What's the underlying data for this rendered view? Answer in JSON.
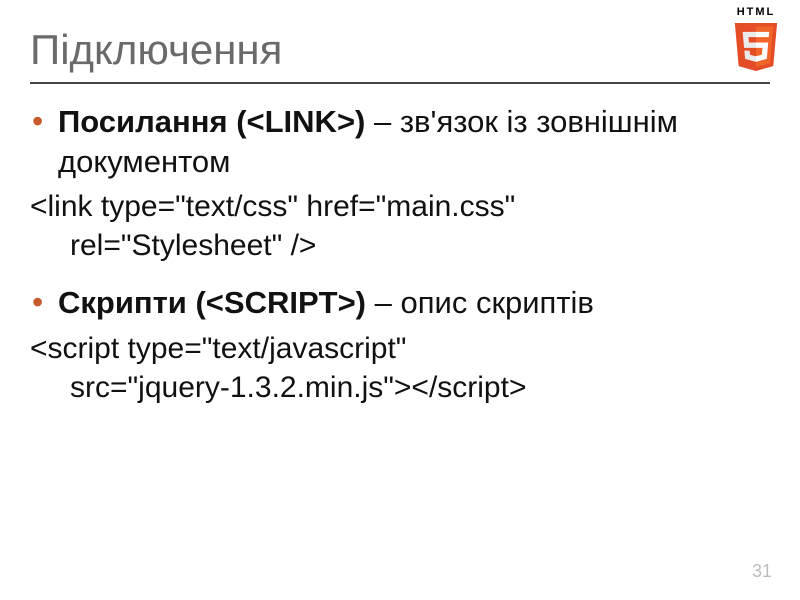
{
  "logo": {
    "label": "HTML"
  },
  "title": "Підключення",
  "bullets": [
    {
      "strong": "Посилання (<LINK>)",
      "rest": " – зв'язок із зовнішнім документом"
    },
    {
      "strong": "Скрипти (<SCRIPT>)",
      "rest": " – опис скриптів"
    }
  ],
  "code": [
    {
      "line1": "<link type=\"text/css\" href=\"main.css\"",
      "line2": "rel=\"Stylesheet\" />"
    },
    {
      "line1": "<script type=\"text/javascript\"",
      "line2": "src=\"jquery-1.3.2.min.js\"></script>"
    }
  ],
  "page_number": "31"
}
